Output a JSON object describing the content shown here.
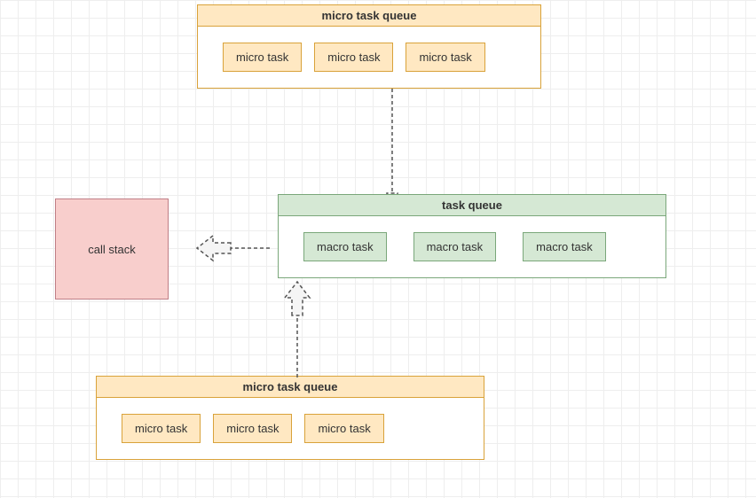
{
  "microQueueTop": {
    "title": "micro task queue",
    "items": [
      "micro task",
      "micro task",
      "micro task"
    ]
  },
  "taskQueue": {
    "title": "task queue",
    "items": [
      "macro task",
      "macro task",
      "macro task"
    ]
  },
  "microQueueBottom": {
    "title": "micro task queue",
    "items": [
      "micro task",
      "micro task",
      "micro task"
    ]
  },
  "callStack": {
    "label": "call stack"
  }
}
